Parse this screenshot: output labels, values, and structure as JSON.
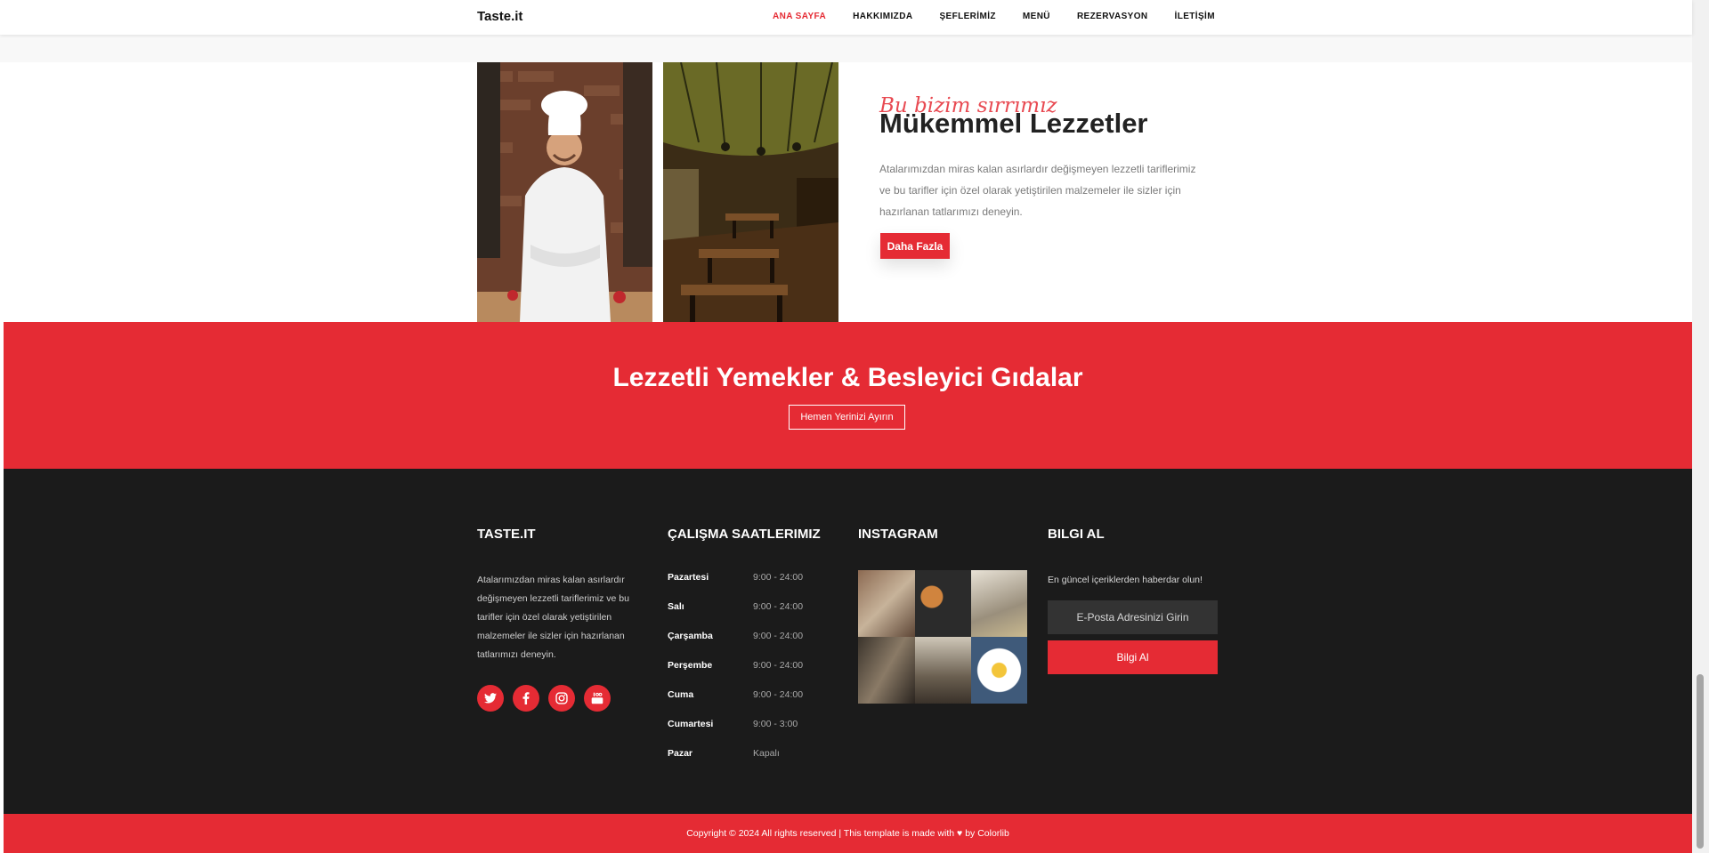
{
  "header": {
    "brand": "Taste.it",
    "nav": [
      "ANA SAYFA",
      "HAKKIMIZDA",
      "ŞEFLERİMİZ",
      "MENÜ",
      "REZERVASYON",
      "İLETİŞİM"
    ]
  },
  "about": {
    "script": "Bu bizim sırrımız",
    "title": "Mükemmel Lezzetler",
    "text": "Atalarımızdan miras kalan asırlardır değişmeyen lezzetli tariflerimiz ve bu tarifler için özel olarak yetiştirilen malzemeler ile sizler için hazırlanan tatlarımızı deneyin.",
    "button": "Daha Fazla"
  },
  "banner": {
    "title": "Lezzetli Yemekler & Besleyici Gıdalar",
    "button": "Hemen Yerinizi Ayırın"
  },
  "footer": {
    "col1_title": "TASTE.IT",
    "col1_text": "Atalarımızdan miras kalan asırlardır değişmeyen lezzetli tariflerimiz ve bu tarifler için özel olarak yetiştirilen malzemeler ile sizler için hazırlanan tatlarımızı deneyin.",
    "social": [
      "twitter-icon",
      "facebook-icon",
      "instagram-icon",
      "youtube-icon"
    ],
    "col2_title": "ÇALIŞMA SAATLERIMIZ",
    "hours": [
      {
        "day": "Pazartesi",
        "time": "9:00 - 24:00"
      },
      {
        "day": "Salı",
        "time": "9:00 - 24:00"
      },
      {
        "day": "Çarşamba",
        "time": "9:00 - 24:00"
      },
      {
        "day": "Perşembe",
        "time": "9:00 - 24:00"
      },
      {
        "day": "Cuma",
        "time": "9:00 - 24:00"
      },
      {
        "day": "Cumartesi",
        "time": "9:00 - 3:00"
      },
      {
        "day": "Pazar",
        "time": "Kapalı"
      }
    ],
    "col3_title": "INSTAGRAM",
    "col4_title": "BILGI AL",
    "subscribe_text": "En güncel içeriklerden haberdar olun!",
    "email_placeholder": "E-Posta Adresinizi Girin",
    "subscribe_button": "Bilgi Al"
  },
  "copyright": {
    "before": "Copyright © 2024 All rights reserved | This template is made with",
    "after": "by Colorlib"
  },
  "colors": {
    "accent": "#e52b34",
    "footer": "#1b1b1b"
  }
}
